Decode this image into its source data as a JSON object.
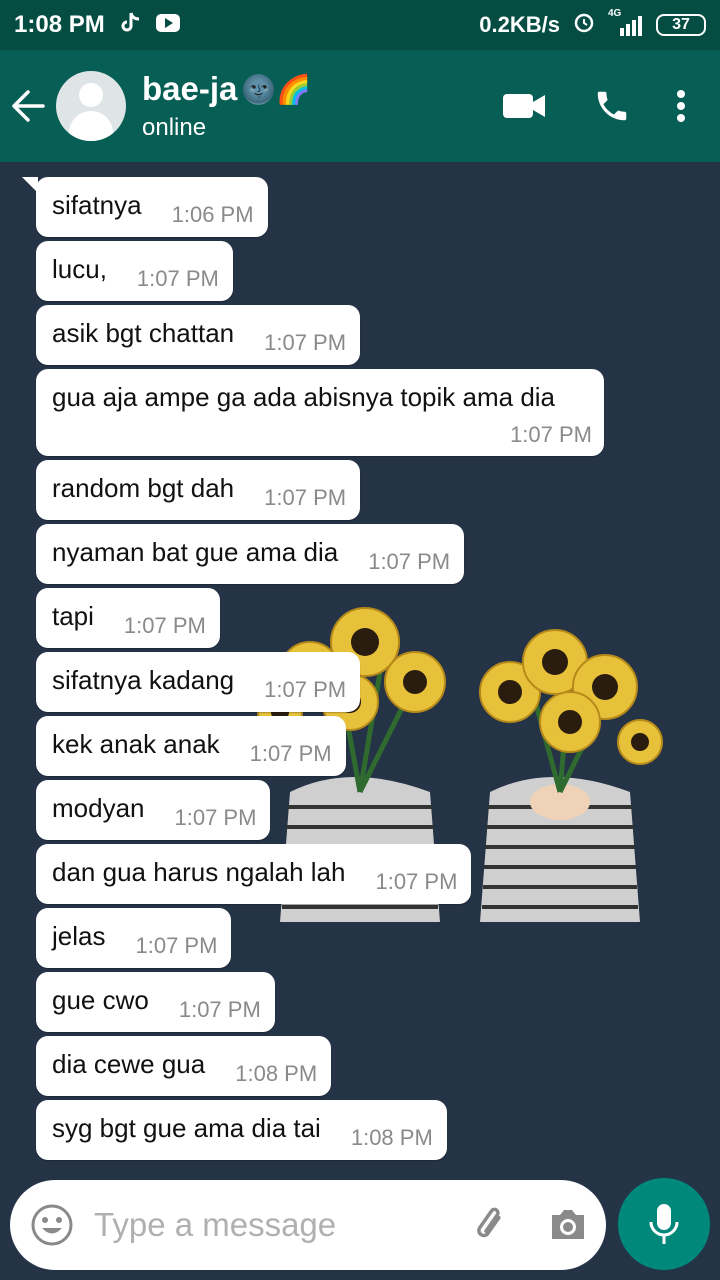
{
  "status_bar": {
    "time": "1:08 PM",
    "network_speed": "0.2KB/s",
    "network_type": "4G",
    "battery": "37",
    "icons": [
      "tiktok-icon",
      "youtube-icon",
      "alarm-icon",
      "signal-icon",
      "battery-icon"
    ]
  },
  "header": {
    "contact_name": "bae-ja",
    "name_emoji": "🌚🌈",
    "presence": "online",
    "icons": [
      "back-arrow-icon",
      "avatar",
      "video-call-icon",
      "voice-call-icon",
      "more-options-icon"
    ]
  },
  "messages": [
    {
      "text": "sifatnya",
      "time": "1:06 PM"
    },
    {
      "text": "lucu,",
      "time": "1:07 PM"
    },
    {
      "text": "asik bgt chattan",
      "time": "1:07 PM"
    },
    {
      "text": "gua aja ampe ga ada abisnya topik ama dia",
      "time": "1:07 PM"
    },
    {
      "text": "random bgt dah",
      "time": "1:07 PM"
    },
    {
      "text": "nyaman bat gue ama dia",
      "time": "1:07 PM"
    },
    {
      "text": "tapi",
      "time": "1:07 PM"
    },
    {
      "text": "sifatnya kadang",
      "time": "1:07 PM"
    },
    {
      "text": "kek anak anak",
      "time": "1:07 PM"
    },
    {
      "text": "modyan",
      "time": "1:07 PM"
    },
    {
      "text": "dan gua harus ngalah lah",
      "time": "1:07 PM"
    },
    {
      "text": "jelas",
      "time": "1:07 PM"
    },
    {
      "text": "gue cwo",
      "time": "1:07 PM"
    },
    {
      "text": "dia cewe gua",
      "time": "1:08 PM"
    },
    {
      "text": "syg bgt gue ama dia tai",
      "time": "1:08 PM"
    }
  ],
  "input": {
    "placeholder": "Type a message",
    "icons": [
      "emoji-icon",
      "attach-icon",
      "camera-icon",
      "mic-icon"
    ]
  },
  "colors": {
    "header": "#075e54",
    "status_bar": "#054d43",
    "chat_background": "#253347",
    "bubble": "#ffffff",
    "mic_button": "#00897b"
  }
}
